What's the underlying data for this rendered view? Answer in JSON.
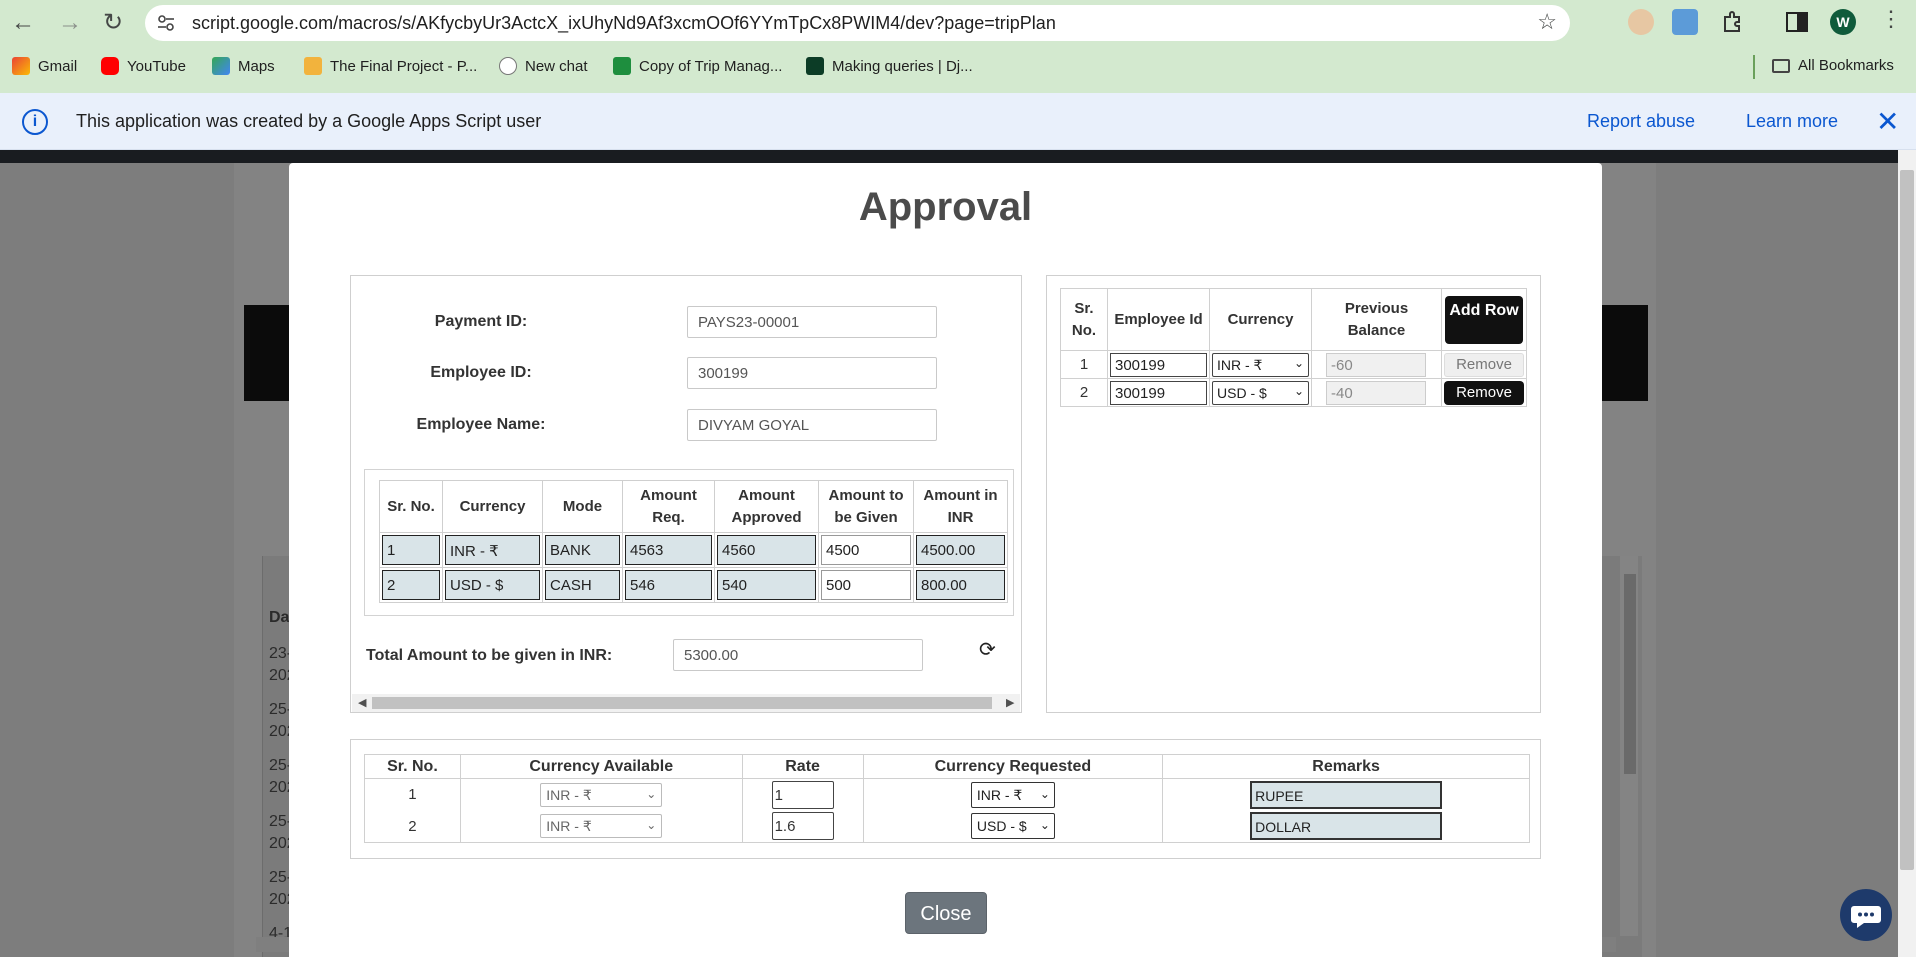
{
  "browser": {
    "url": "script.google.com/macros/s/AKfycbyUr3ActcX_ixUhyNd9Af3xcmOOf6YYmTpCx8PWIM4/dev?page=tripPlan",
    "avatar_letter": "W",
    "bookmarks": [
      "Gmail",
      "YouTube",
      "Maps",
      "The Final Project - P...",
      "New chat",
      "Copy of Trip Manag...",
      "Making queries | Dj..."
    ],
    "all_bookmarks": "All Bookmarks"
  },
  "infobar": {
    "message": "This application was created by a Google Apps Script user",
    "report_abuse": "Report abuse",
    "learn_more": "Learn more"
  },
  "background": {
    "row_texts": [
      "Da",
      "23-",
      "202",
      "25-",
      "202",
      "25-",
      "202",
      "25-",
      "202",
      "25-",
      "202",
      "4-1"
    ]
  },
  "modal": {
    "title": "Approval",
    "form": {
      "payment_id_label": "Payment ID:",
      "payment_id_value": "PAYS23-00001",
      "employee_id_label": "Employee ID:",
      "employee_id_value": "300199",
      "employee_name_label": "Employee Name:",
      "employee_name_value": "DIVYAM GOYAL"
    },
    "payment_table": {
      "headers": [
        "Sr. No.",
        "Currency",
        "Mode",
        "Amount Req.",
        "Amount Approved",
        "Amount to be Given",
        "Amount in INR"
      ],
      "rows": [
        [
          "1",
          "INR - ₹",
          "BANK",
          "4563",
          "4560",
          "4500",
          "4500.00"
        ],
        [
          "2",
          "USD - $",
          "CASH",
          "546",
          "540",
          "500",
          "800.00"
        ]
      ]
    },
    "total": {
      "label": "Total Amount to be given in INR:",
      "value": "5300.00"
    },
    "employee_table": {
      "headers": [
        "Sr. No.",
        "Employee Id",
        "Currency",
        "Previous Balance"
      ],
      "add_row": "Add Row",
      "rows": [
        {
          "sr": "1",
          "employee_id": "300199",
          "currency": "INR - ₹",
          "previous_balance": "-60",
          "remove": "Remove"
        },
        {
          "sr": "2",
          "employee_id": "300199",
          "currency": "USD - $",
          "previous_balance": "-40",
          "remove": "Remove"
        }
      ]
    },
    "currency_table": {
      "headers": [
        "Sr. No.",
        "Currency Available",
        "Rate",
        "Currency Requested",
        "Remarks"
      ],
      "rows": [
        {
          "sr": "1",
          "available": "INR - ₹",
          "rate": "1",
          "requested": "INR - ₹",
          "remarks": "RUPEE"
        },
        {
          "sr": "2",
          "available": "INR - ₹",
          "rate": "1.6",
          "requested": "USD - $",
          "remarks": "DOLLAR"
        }
      ]
    },
    "close": "Close"
  }
}
